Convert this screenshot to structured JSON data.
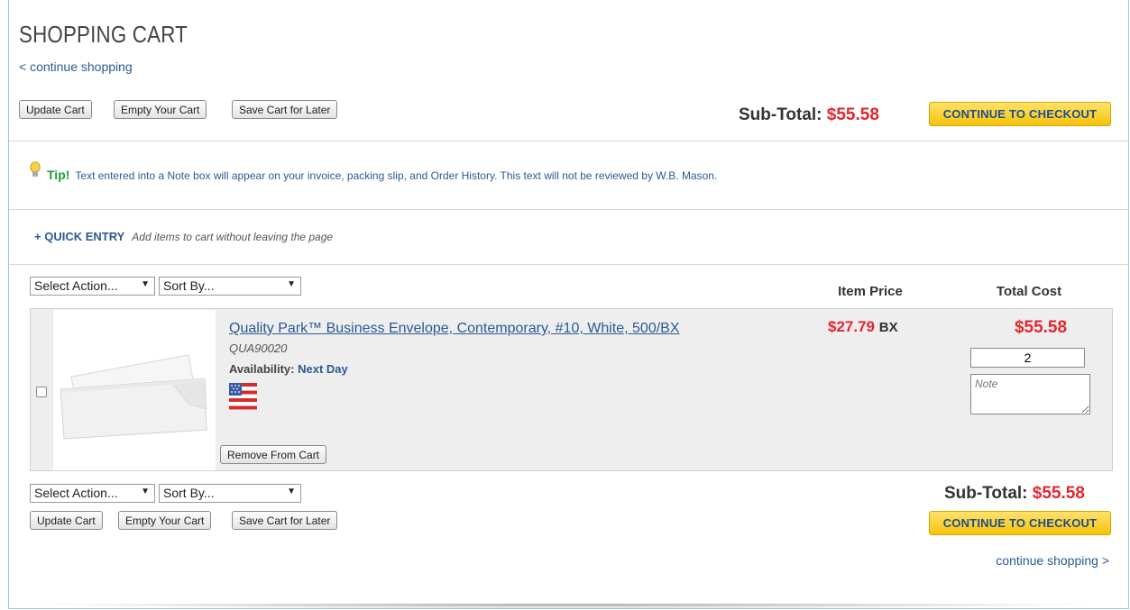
{
  "page": {
    "title": "SHOPPING CART",
    "continue_top": "< continue shopping",
    "continue_bottom": "continue shopping >"
  },
  "toolbar": {
    "update_label": "Update Cart",
    "empty_label": "Empty Your Cart",
    "save_label": "Save Cart for Later"
  },
  "summary": {
    "subtotal_label": "Sub-Total:",
    "subtotal_value": "$55.58",
    "checkout_label": "CONTINUE TO CHECKOUT"
  },
  "tip": {
    "label": "Tip!",
    "text": "Text entered into a Note box will appear on your invoice, packing slip, and Order History. This text will not be reviewed by W.B. Mason."
  },
  "quick_entry": {
    "link": "+ QUICK ENTRY",
    "description": "Add items to cart without leaving the page"
  },
  "controls": {
    "action_select": "Select Action...",
    "sort_select": "Sort By..."
  },
  "columns": {
    "item_price": "Item Price",
    "total_cost": "Total Cost"
  },
  "items": [
    {
      "name": "Quality Park™ Business Envelope, Contemporary, #10, White, 500/BX",
      "sku": "QUA90020",
      "availability_label": "Availability:",
      "availability_value": "Next Day",
      "price": "$27.79",
      "unit": "BX",
      "total": "$55.58",
      "quantity": "2",
      "note_placeholder": "Note",
      "remove_label": "Remove From Cart",
      "checked": false
    }
  ],
  "colors": {
    "price_red": "#e3262f",
    "link_blue": "#2a5a93",
    "checkout_yellow": "#f6c20a",
    "tip_green": "#1e9e3a"
  },
  "icons": [
    "lightbulb-icon",
    "us-flag-icon",
    "dropdown-arrow-icon"
  ]
}
